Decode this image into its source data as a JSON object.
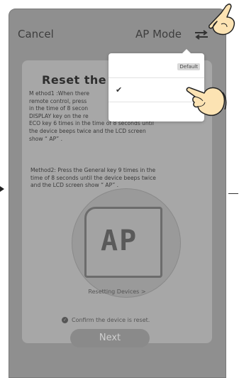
{
  "header": {
    "cancel_label": "Cancel",
    "title": "AP Mode",
    "switch_icon": "swap-arrows-icon"
  },
  "dropdown": {
    "default_label": "Default",
    "check_icon": "checkmark-icon"
  },
  "card": {
    "title": "Reset the d",
    "method1": "Method1:When there is remote control, press the MODE key... in the time of 8 seconds ... DISPLAY key on the re... ECO key 6 times in ... the device beeps twice and the LCD screen show “ AP” .",
    "method1_lines": [
      "M ethod1 :When there",
      "remote control, press",
      "in the time of 8 secon",
      "DISPLAY key on the re",
      "ECO key 6 times in the time of 8 seconds until",
      "the device beeps twice and the LCD screen",
      "show “ AP” ."
    ],
    "method2_lines": [
      "Method2: Press the General key 9 times in the",
      "time of 8 seconds until the device beeps twice",
      "and the LCD screen show “ AP” ."
    ],
    "lcd_text": "AP",
    "resetting_link": "Resetting Devices >",
    "confirm_label": "Confirm the device is reset.",
    "next_label": "Next"
  },
  "colors": {
    "overlay_bg": "#8f8f8f",
    "card_bg": "#a7a7a7",
    "hand_fill": "#fce3b3",
    "hand_stroke": "#222222"
  }
}
